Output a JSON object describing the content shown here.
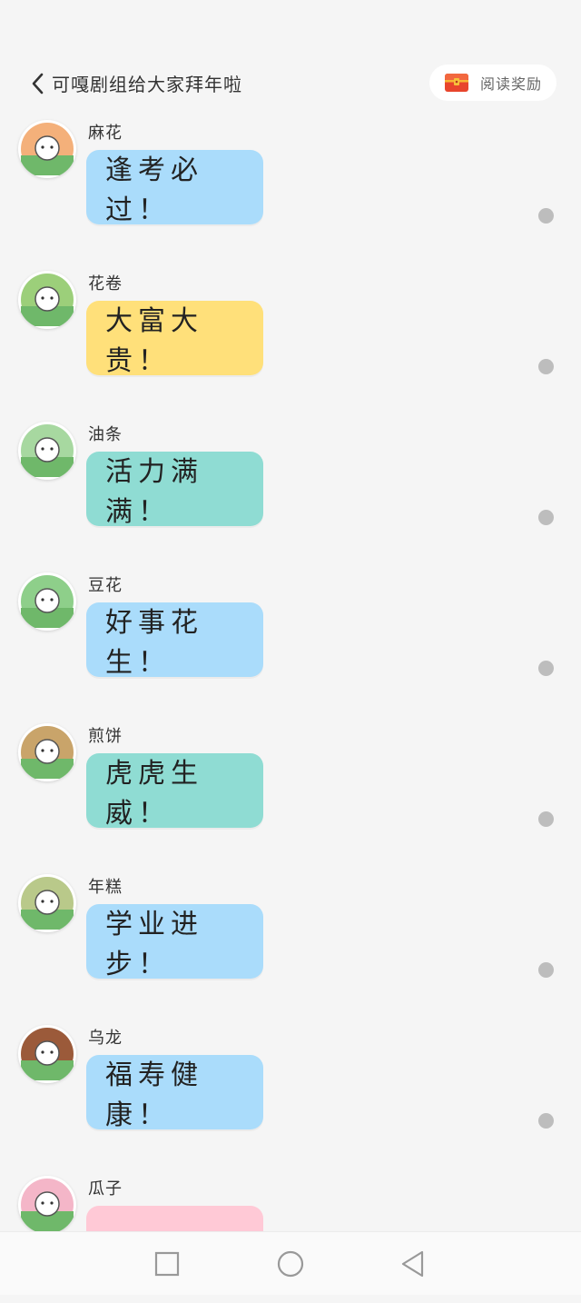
{
  "header": {
    "title": "可嘎剧组给大家拜年啦",
    "reward_label": "阅读奖励",
    "back_icon": "chevron-left-icon",
    "reward_icon": "treasure-chest-icon"
  },
  "messages": [
    {
      "name": "麻花",
      "text": "逢考必过！",
      "bubble_color": "#aadcfb",
      "avatar_color": "#f4b07a"
    },
    {
      "name": "花卷",
      "text": "大富大贵！",
      "bubble_color": "#ffe07a",
      "avatar_color": "#9ccf7a"
    },
    {
      "name": "油条",
      "text": "活力满满！",
      "bubble_color": "#8fdcd3",
      "avatar_color": "#a7d8a0"
    },
    {
      "name": "豆花",
      "text": "好事花生！",
      "bubble_color": "#aadcfb",
      "avatar_color": "#8ecf8a"
    },
    {
      "name": "煎饼",
      "text": "虎虎生威！",
      "bubble_color": "#8fdcd3",
      "avatar_color": "#c9a46a"
    },
    {
      "name": "年糕",
      "text": "学业进步！",
      "bubble_color": "#aadcfb",
      "avatar_color": "#b9c98a"
    },
    {
      "name": "乌龙",
      "text": "福寿健康！",
      "bubble_color": "#aadcfb",
      "avatar_color": "#9b5a3a"
    },
    {
      "name": "瓜子",
      "text": "",
      "bubble_color": "#ffc9d6",
      "avatar_color": "#f4b6c8"
    }
  ],
  "navbar": {
    "recent_icon": "square-recent-apps-icon",
    "home_icon": "circle-home-icon",
    "back_icon": "triangle-back-icon"
  }
}
